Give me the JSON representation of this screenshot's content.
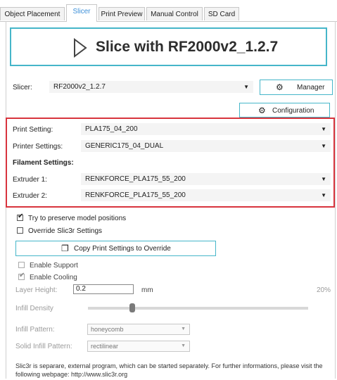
{
  "tabs": [
    {
      "label": "Object Placement",
      "active": false
    },
    {
      "label": "Slicer",
      "active": true
    },
    {
      "label": "Print Preview",
      "active": false
    },
    {
      "label": "Manual Control",
      "active": false
    },
    {
      "label": "SD Card",
      "active": false
    }
  ],
  "slice_button": {
    "label": "Slice with RF2000v2_1.2.7",
    "icon": "play-icon"
  },
  "slicer": {
    "label": "Slicer:",
    "value": "RF2000v2_1.2.7",
    "manager_label": "Manager",
    "manager_icon": "gear-icon"
  },
  "configuration": {
    "label": "Configuration",
    "icon": "gear-icon"
  },
  "settings": {
    "print_setting_label": "Print Setting:",
    "print_setting_value": "PLA175_04_200",
    "printer_settings_label": "Printer Settings:",
    "printer_settings_value": "GENERIC175_04_DUAL",
    "filament_heading": "Filament Settings:",
    "extruder1_label": "Extruder 1:",
    "extruder1_value": "RENKFORCE_PLA175_55_200",
    "extruder2_label": "Extruder 2:",
    "extruder2_value": "RENKFORCE_PLA175_55_200"
  },
  "options": {
    "preserve_label": "Try to preserve model positions",
    "preserve_checked": true,
    "override_label": "Override Slic3r Settings",
    "override_checked": false,
    "copy_button_label": "Copy Print Settings to Override",
    "copy_icon": "copy-icon",
    "enable_support_label": "Enable Support",
    "enable_support_checked": false,
    "enable_cooling_label": "Enable Cooling",
    "enable_cooling_checked": true,
    "layer_height_label": "Layer Height:",
    "layer_height_value": "0.2",
    "layer_height_unit": "mm",
    "infill_percent": "20%",
    "infill_density_label": "Infill Density",
    "infill_density_fraction": 0.2,
    "infill_pattern_label": "Infill Pattern:",
    "infill_pattern_value": "honeycomb",
    "solid_infill_label": "Solid Infill Pattern:",
    "solid_infill_value": "rectilinear"
  },
  "footer_text": "Slic3r is separare, external program, which can be started separately. For further informations, please visit the following webpage: http://www.slic3r.org",
  "colors": {
    "accent": "#46b6c9",
    "highlight": "#d8343d",
    "active_tab": "#3c8fd8"
  }
}
